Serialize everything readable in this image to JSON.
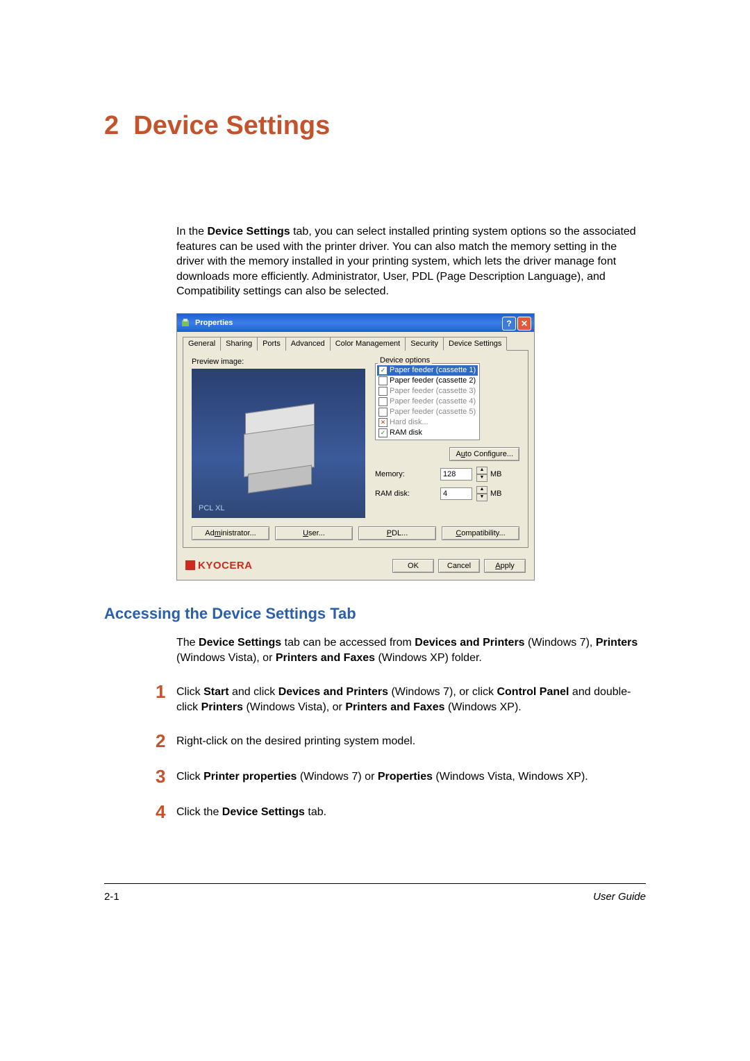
{
  "chapter": {
    "number": "2",
    "title": "Device Settings"
  },
  "intro": {
    "text_before_bold": "In the ",
    "bold1": "Device Settings",
    "text_after": " tab, you can select installed printing system options so the associated features can be used with the printer driver. You can also match the memory setting in the driver with the memory installed in your printing system, which lets the driver manage font downloads more efficiently. Administrator, User, PDL (Page Description Language), and Compatibility settings can also be selected."
  },
  "dialog": {
    "title": "Properties",
    "tabs": [
      "General",
      "Sharing",
      "Ports",
      "Advanced",
      "Color Management",
      "Security",
      "Device Settings"
    ],
    "active_tab": 6,
    "preview_label": "Preview image:",
    "preview_mode": "PCL XL",
    "device_options_label": "Device options",
    "options": [
      {
        "label": "Paper feeder (cassette 1)",
        "checked": true,
        "selected": true
      },
      {
        "label": "Paper feeder (cassette 2)",
        "checked": false
      },
      {
        "label": "Paper feeder (cassette 3)",
        "checked": false,
        "disabled": true
      },
      {
        "label": "Paper feeder (cassette 4)",
        "checked": false,
        "disabled": true
      },
      {
        "label": "Paper feeder (cassette 5)",
        "checked": false,
        "disabled": true
      },
      {
        "label": "Hard disk...",
        "checked": true,
        "xmark": true,
        "disabled": true
      },
      {
        "label": "RAM disk",
        "checked": true
      }
    ],
    "auto_configure": "Auto Configure...",
    "memory_label": "Memory:",
    "memory_value": "128",
    "memory_unit": "MB",
    "ramdisk_label": "RAM disk:",
    "ramdisk_value": "4",
    "ramdisk_unit": "MB",
    "administrator": "Administrator...",
    "user": "User...",
    "pdl": "PDL...",
    "compat": "Compatibility...",
    "brand": "KYOCERA",
    "ok": "OK",
    "cancel": "Cancel",
    "apply": "Apply"
  },
  "section_heading": "Accessing the Device Settings Tab",
  "body_para": {
    "p1": "The ",
    "b1": "Device Settings",
    "p2": " tab can be accessed from ",
    "b2": "Devices and Printers",
    "p3": " (Windows 7), ",
    "b3": "Printers",
    "p4": " (Windows Vista), or ",
    "b4": "Printers and Faxes",
    "p5": " (Windows XP) folder."
  },
  "steps": {
    "n1": "1",
    "s1_p1": "Click ",
    "s1_b1": "Start",
    "s1_p2": " and click ",
    "s1_b2": "Devices and Printers",
    "s1_p3": " (Windows 7), or click ",
    "s1_b3": "Control Panel",
    "s1_p4": " and double-click ",
    "s1_b4": "Printers",
    "s1_p5": " (Windows Vista), or ",
    "s1_b5": "Printers and Faxes",
    "s1_p6": " (Windows XP).",
    "n2": "2",
    "s2": "Right-click on the desired printing system model.",
    "n3": "3",
    "s3_p1": "Click ",
    "s3_b1": "Printer properties",
    "s3_p2": " (Windows 7) or ",
    "s3_b2": "Properties",
    "s3_p3": " (Windows Vista, Windows XP).",
    "n4": "4",
    "s4_p1": "Click the ",
    "s4_b1": "Device Settings",
    "s4_p2": " tab."
  },
  "footer": {
    "left": "2-1",
    "right": "User Guide"
  }
}
